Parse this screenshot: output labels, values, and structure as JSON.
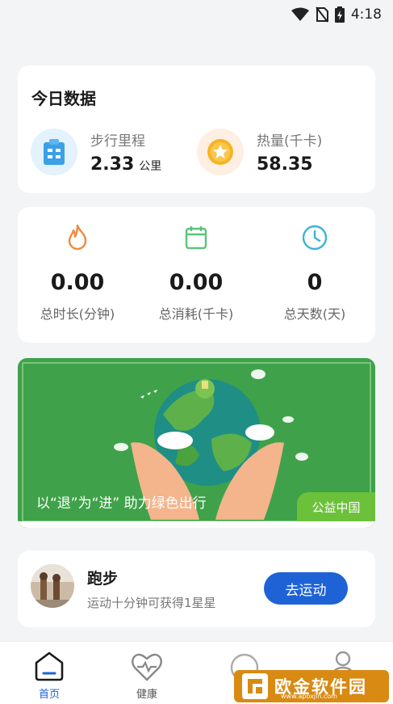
{
  "status_bar": {
    "time": "4:18"
  },
  "today": {
    "title": "今日数据",
    "distance": {
      "label": "步行里程",
      "value": "2.33",
      "unit": "公里",
      "icon": "clipboard-icon"
    },
    "calories": {
      "label": "热量(千卡)",
      "value": "58.35",
      "icon": "star-coin-icon"
    }
  },
  "stats": [
    {
      "icon": "flame-icon",
      "value": "0.00",
      "label": "总时长(分钟)"
    },
    {
      "icon": "calendar-icon",
      "value": "0.00",
      "label": "总消耗(千卡)"
    },
    {
      "icon": "clock-icon",
      "value": "0",
      "label": "总天数(天)"
    }
  ],
  "banner": {
    "caption": "以“退”为“进” 助力绿色出行",
    "tag": "公益中国"
  },
  "activity": {
    "title": "跑步",
    "description": "运动十分钟可获得1星星",
    "button": "去运动"
  },
  "tabs": [
    {
      "label": "首页",
      "icon": "home-icon",
      "active": true
    },
    {
      "label": "健康",
      "icon": "heart-icon",
      "active": false
    }
  ],
  "watermark": {
    "text": "欧金软件园",
    "sub": "www.apoxjin.com"
  },
  "colors": {
    "accent": "#1e63d6",
    "banner_green": "#3fa24a",
    "tag_green": "#6cc13b"
  }
}
